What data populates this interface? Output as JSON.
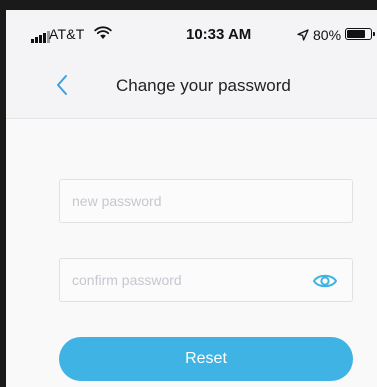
{
  "status_bar": {
    "carrier": "AT&T",
    "time": "10:33 AM",
    "battery_percent": "80%",
    "battery_level": 0.8,
    "signal_bars": 4,
    "icons": [
      "signal-icon",
      "wifi-icon",
      "location-arrow-icon",
      "battery-icon"
    ]
  },
  "nav": {
    "back_icon": "chevron-left-icon",
    "title": "Change your password"
  },
  "form": {
    "new_password": {
      "value": "",
      "placeholder": "new password"
    },
    "confirm_password": {
      "value": "",
      "placeholder": "confirm password",
      "toggle_icon": "eye-icon"
    },
    "reset_label": "Reset"
  },
  "colors": {
    "accent": "#3fb3e4",
    "back_icon": "#3f9fe0",
    "placeholder": "#c6c8cf"
  }
}
